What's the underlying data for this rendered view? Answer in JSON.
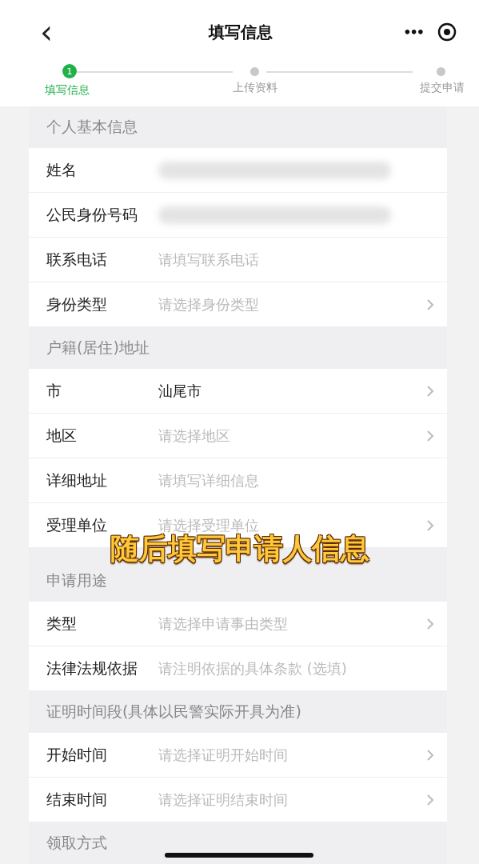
{
  "header": {
    "back": "‹",
    "title": "填写信息",
    "more": "•••"
  },
  "steps": [
    {
      "number": "1",
      "label": "填写信息",
      "selected": true
    },
    {
      "label": "上传资料",
      "selected": false
    },
    {
      "label": "提交申请",
      "selected": false
    }
  ],
  "sections": [
    {
      "title": "个人基本信息",
      "rows": [
        {
          "label": "姓名",
          "kind": "blurred"
        },
        {
          "label": "公民身份号码",
          "kind": "blurred"
        },
        {
          "label": "联系电话",
          "kind": "input",
          "placeholder": "请填写联系电话"
        },
        {
          "label": "身份类型",
          "kind": "select",
          "placeholder": "请选择身份类型"
        }
      ]
    },
    {
      "title": "户籍(居住)地址",
      "rows": [
        {
          "label": "市",
          "kind": "select",
          "value": "汕尾市"
        },
        {
          "label": "地区",
          "kind": "select",
          "placeholder": "请选择地区"
        },
        {
          "label": "详细地址",
          "kind": "input",
          "placeholder": "请填写详细信息"
        },
        {
          "label": "受理单位",
          "kind": "select",
          "placeholder": "请选择受理单位"
        }
      ]
    },
    {
      "title": "申请用途",
      "rows": [
        {
          "label": "类型",
          "kind": "select",
          "placeholder": "请选择申请事由类型"
        },
        {
          "label": "法律法规依据",
          "kind": "input",
          "placeholder": "请注明依据的具体条款 (选填)"
        }
      ]
    },
    {
      "title": "证明时间段(具体以民警实际开具为准)",
      "rows": [
        {
          "label": "开始时间",
          "kind": "select",
          "placeholder": "请选择证明开始时间"
        },
        {
          "label": "结束时间",
          "kind": "select",
          "placeholder": "请选择证明结束时间"
        }
      ]
    },
    {
      "title": "领取方式"
    }
  ],
  "caption": "随后填写申请人信息"
}
